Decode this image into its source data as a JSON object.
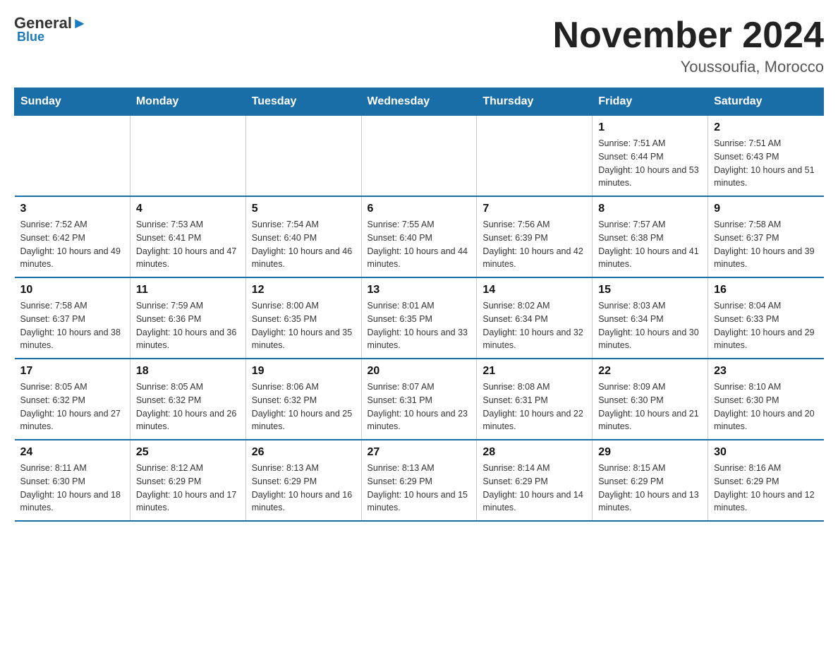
{
  "header": {
    "logo_general": "General",
    "logo_blue": "Blue",
    "month_title": "November 2024",
    "location": "Youssoufia, Morocco"
  },
  "days_of_week": [
    "Sunday",
    "Monday",
    "Tuesday",
    "Wednesday",
    "Thursday",
    "Friday",
    "Saturday"
  ],
  "weeks": [
    [
      {
        "day": "",
        "sunrise": "",
        "sunset": "",
        "daylight": ""
      },
      {
        "day": "",
        "sunrise": "",
        "sunset": "",
        "daylight": ""
      },
      {
        "day": "",
        "sunrise": "",
        "sunset": "",
        "daylight": ""
      },
      {
        "day": "",
        "sunrise": "",
        "sunset": "",
        "daylight": ""
      },
      {
        "day": "",
        "sunrise": "",
        "sunset": "",
        "daylight": ""
      },
      {
        "day": "1",
        "sunrise": "Sunrise: 7:51 AM",
        "sunset": "Sunset: 6:44 PM",
        "daylight": "Daylight: 10 hours and 53 minutes."
      },
      {
        "day": "2",
        "sunrise": "Sunrise: 7:51 AM",
        "sunset": "Sunset: 6:43 PM",
        "daylight": "Daylight: 10 hours and 51 minutes."
      }
    ],
    [
      {
        "day": "3",
        "sunrise": "Sunrise: 7:52 AM",
        "sunset": "Sunset: 6:42 PM",
        "daylight": "Daylight: 10 hours and 49 minutes."
      },
      {
        "day": "4",
        "sunrise": "Sunrise: 7:53 AM",
        "sunset": "Sunset: 6:41 PM",
        "daylight": "Daylight: 10 hours and 47 minutes."
      },
      {
        "day": "5",
        "sunrise": "Sunrise: 7:54 AM",
        "sunset": "Sunset: 6:40 PM",
        "daylight": "Daylight: 10 hours and 46 minutes."
      },
      {
        "day": "6",
        "sunrise": "Sunrise: 7:55 AM",
        "sunset": "Sunset: 6:40 PM",
        "daylight": "Daylight: 10 hours and 44 minutes."
      },
      {
        "day": "7",
        "sunrise": "Sunrise: 7:56 AM",
        "sunset": "Sunset: 6:39 PM",
        "daylight": "Daylight: 10 hours and 42 minutes."
      },
      {
        "day": "8",
        "sunrise": "Sunrise: 7:57 AM",
        "sunset": "Sunset: 6:38 PM",
        "daylight": "Daylight: 10 hours and 41 minutes."
      },
      {
        "day": "9",
        "sunrise": "Sunrise: 7:58 AM",
        "sunset": "Sunset: 6:37 PM",
        "daylight": "Daylight: 10 hours and 39 minutes."
      }
    ],
    [
      {
        "day": "10",
        "sunrise": "Sunrise: 7:58 AM",
        "sunset": "Sunset: 6:37 PM",
        "daylight": "Daylight: 10 hours and 38 minutes."
      },
      {
        "day": "11",
        "sunrise": "Sunrise: 7:59 AM",
        "sunset": "Sunset: 6:36 PM",
        "daylight": "Daylight: 10 hours and 36 minutes."
      },
      {
        "day": "12",
        "sunrise": "Sunrise: 8:00 AM",
        "sunset": "Sunset: 6:35 PM",
        "daylight": "Daylight: 10 hours and 35 minutes."
      },
      {
        "day": "13",
        "sunrise": "Sunrise: 8:01 AM",
        "sunset": "Sunset: 6:35 PM",
        "daylight": "Daylight: 10 hours and 33 minutes."
      },
      {
        "day": "14",
        "sunrise": "Sunrise: 8:02 AM",
        "sunset": "Sunset: 6:34 PM",
        "daylight": "Daylight: 10 hours and 32 minutes."
      },
      {
        "day": "15",
        "sunrise": "Sunrise: 8:03 AM",
        "sunset": "Sunset: 6:34 PM",
        "daylight": "Daylight: 10 hours and 30 minutes."
      },
      {
        "day": "16",
        "sunrise": "Sunrise: 8:04 AM",
        "sunset": "Sunset: 6:33 PM",
        "daylight": "Daylight: 10 hours and 29 minutes."
      }
    ],
    [
      {
        "day": "17",
        "sunrise": "Sunrise: 8:05 AM",
        "sunset": "Sunset: 6:32 PM",
        "daylight": "Daylight: 10 hours and 27 minutes."
      },
      {
        "day": "18",
        "sunrise": "Sunrise: 8:05 AM",
        "sunset": "Sunset: 6:32 PM",
        "daylight": "Daylight: 10 hours and 26 minutes."
      },
      {
        "day": "19",
        "sunrise": "Sunrise: 8:06 AM",
        "sunset": "Sunset: 6:32 PM",
        "daylight": "Daylight: 10 hours and 25 minutes."
      },
      {
        "day": "20",
        "sunrise": "Sunrise: 8:07 AM",
        "sunset": "Sunset: 6:31 PM",
        "daylight": "Daylight: 10 hours and 23 minutes."
      },
      {
        "day": "21",
        "sunrise": "Sunrise: 8:08 AM",
        "sunset": "Sunset: 6:31 PM",
        "daylight": "Daylight: 10 hours and 22 minutes."
      },
      {
        "day": "22",
        "sunrise": "Sunrise: 8:09 AM",
        "sunset": "Sunset: 6:30 PM",
        "daylight": "Daylight: 10 hours and 21 minutes."
      },
      {
        "day": "23",
        "sunrise": "Sunrise: 8:10 AM",
        "sunset": "Sunset: 6:30 PM",
        "daylight": "Daylight: 10 hours and 20 minutes."
      }
    ],
    [
      {
        "day": "24",
        "sunrise": "Sunrise: 8:11 AM",
        "sunset": "Sunset: 6:30 PM",
        "daylight": "Daylight: 10 hours and 18 minutes."
      },
      {
        "day": "25",
        "sunrise": "Sunrise: 8:12 AM",
        "sunset": "Sunset: 6:29 PM",
        "daylight": "Daylight: 10 hours and 17 minutes."
      },
      {
        "day": "26",
        "sunrise": "Sunrise: 8:13 AM",
        "sunset": "Sunset: 6:29 PM",
        "daylight": "Daylight: 10 hours and 16 minutes."
      },
      {
        "day": "27",
        "sunrise": "Sunrise: 8:13 AM",
        "sunset": "Sunset: 6:29 PM",
        "daylight": "Daylight: 10 hours and 15 minutes."
      },
      {
        "day": "28",
        "sunrise": "Sunrise: 8:14 AM",
        "sunset": "Sunset: 6:29 PM",
        "daylight": "Daylight: 10 hours and 14 minutes."
      },
      {
        "day": "29",
        "sunrise": "Sunrise: 8:15 AM",
        "sunset": "Sunset: 6:29 PM",
        "daylight": "Daylight: 10 hours and 13 minutes."
      },
      {
        "day": "30",
        "sunrise": "Sunrise: 8:16 AM",
        "sunset": "Sunset: 6:29 PM",
        "daylight": "Daylight: 10 hours and 12 minutes."
      }
    ]
  ]
}
